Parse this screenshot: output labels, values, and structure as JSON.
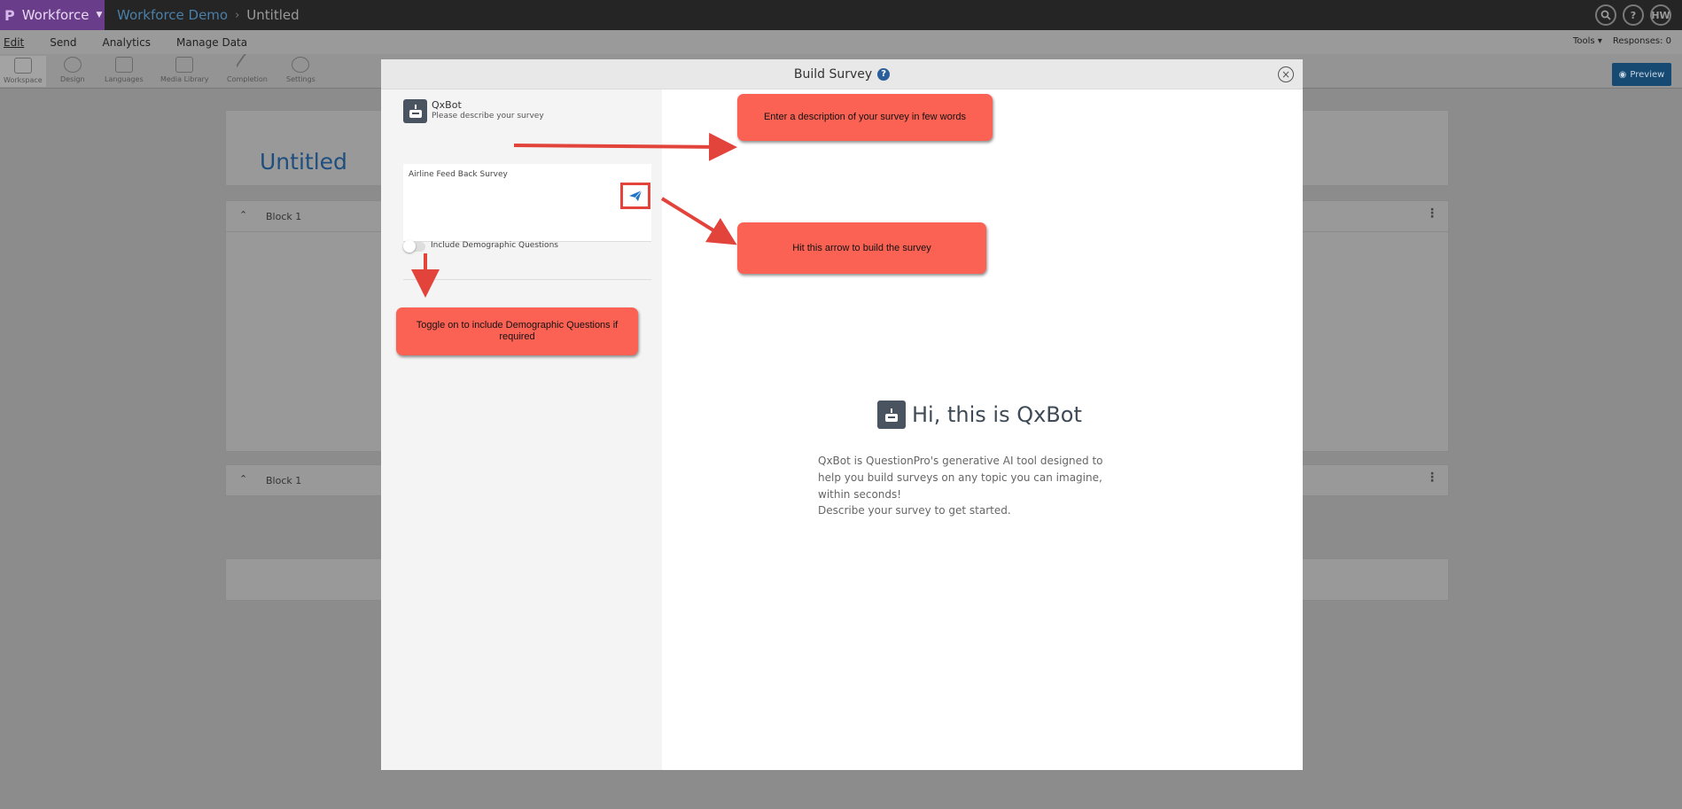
{
  "topbar": {
    "logo_letter": "P",
    "brand": "Workforce",
    "breadcrumb_project": "Workforce Demo",
    "breadcrumb_sep": "›",
    "breadcrumb_survey": "Untitled",
    "user_initials": "HW"
  },
  "menu": {
    "items": [
      "Edit",
      "Send",
      "Analytics",
      "Manage Data"
    ],
    "tools": "Tools ▾",
    "responses": "Responses: 0"
  },
  "toolbar": {
    "items": [
      "Workspace",
      "Design",
      "Languages",
      "Media Library",
      "Completion",
      "Settings"
    ],
    "preview": "Preview"
  },
  "page": {
    "survey_title": "Untitled",
    "blocks": [
      "Block 1",
      "Block 1"
    ]
  },
  "modal": {
    "title": "Build Survey",
    "qxbot_name": "QxBot",
    "qxbot_prompt": "Please describe your survey",
    "description_value": "Airline Feed Back Survey",
    "toggle_label": "Include Demographic Questions",
    "toggle_on": false,
    "hi_title": "Hi, this is QxBot",
    "hi_body": "QxBot is QuestionPro's generative AI tool designed to help you build surveys on any topic you can imagine, within seconds!",
    "hi_cta": "Describe your survey to get started."
  },
  "annotations": {
    "describe": "Enter a description of your survey in few words",
    "arrow": "Hit this arrow to build the survey",
    "toggle": "Toggle on to include Demographic Questions if required"
  },
  "colors": {
    "brand_purple": "#6a3d8a",
    "callout": "#fb6254",
    "callout_border": "#e2433b",
    "preview_blue": "#174a73"
  }
}
